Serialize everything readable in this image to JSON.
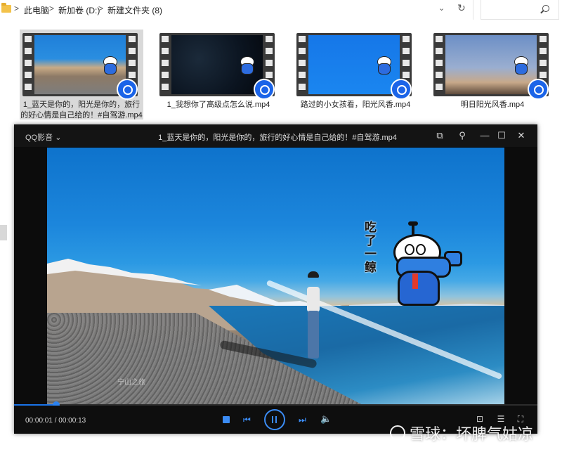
{
  "explorer": {
    "breadcrumbs": [
      "此电脑",
      "新加卷 (D:)",
      "新建文件夹 (8)"
    ],
    "separators": [
      ">",
      ">",
      ">"
    ],
    "dropdown_icon": "chevron-down-icon",
    "refresh_icon": "refresh-icon",
    "search_icon": "search-icon"
  },
  "thumbnails": [
    {
      "label": "1_蓝天是你的，阳光是你的，旅行的好心情是自己给的！#自驾游.mp4",
      "selected": true
    },
    {
      "label": "1_我想你了高级点怎么说.mp4",
      "selected": false
    },
    {
      "label": "路过的小女孩看，阳光风香.mp4",
      "selected": false
    },
    {
      "label": "明日阳光风香.mp4",
      "selected": false
    }
  ],
  "player": {
    "brand": "QQ影音",
    "brand_chevron": "⌄",
    "title": "1_蓝天是你的，阳光是你的，旅行的好心情是自己给的！#自驾游.mp4",
    "titlebar_icons": [
      "screenshot-icon",
      "pin-icon",
      "minimize-icon",
      "maximize-icon",
      "close-icon"
    ],
    "titlebar_glyphs": [
      "⧉",
      "⚲",
      "—",
      "☐",
      "✕"
    ],
    "sticker_text": "吃了一鲸",
    "video_watermark": "宁山之旅",
    "current_time": "00:00:01",
    "total_time": "00:00:13",
    "time_display": "00:00:01 / 00:00:13",
    "progress": 0.08,
    "controls": {
      "stop": "stop-icon",
      "prev": "previous-icon",
      "play_pause": "pause-icon",
      "next": "next-icon",
      "volume": "volume-icon"
    },
    "control_glyphs": {
      "prev": "⏮",
      "next": "⏭",
      "volume": "🔈"
    },
    "right_icons": [
      "crop-icon",
      "settings-sliders-icon",
      "fullscreen-icon"
    ],
    "right_glyphs": [
      "⊡",
      "☰",
      "⛶"
    ],
    "accent_color": "#3b8cf5"
  },
  "watermark": {
    "text": "雪球：坏脾气姑凉"
  }
}
